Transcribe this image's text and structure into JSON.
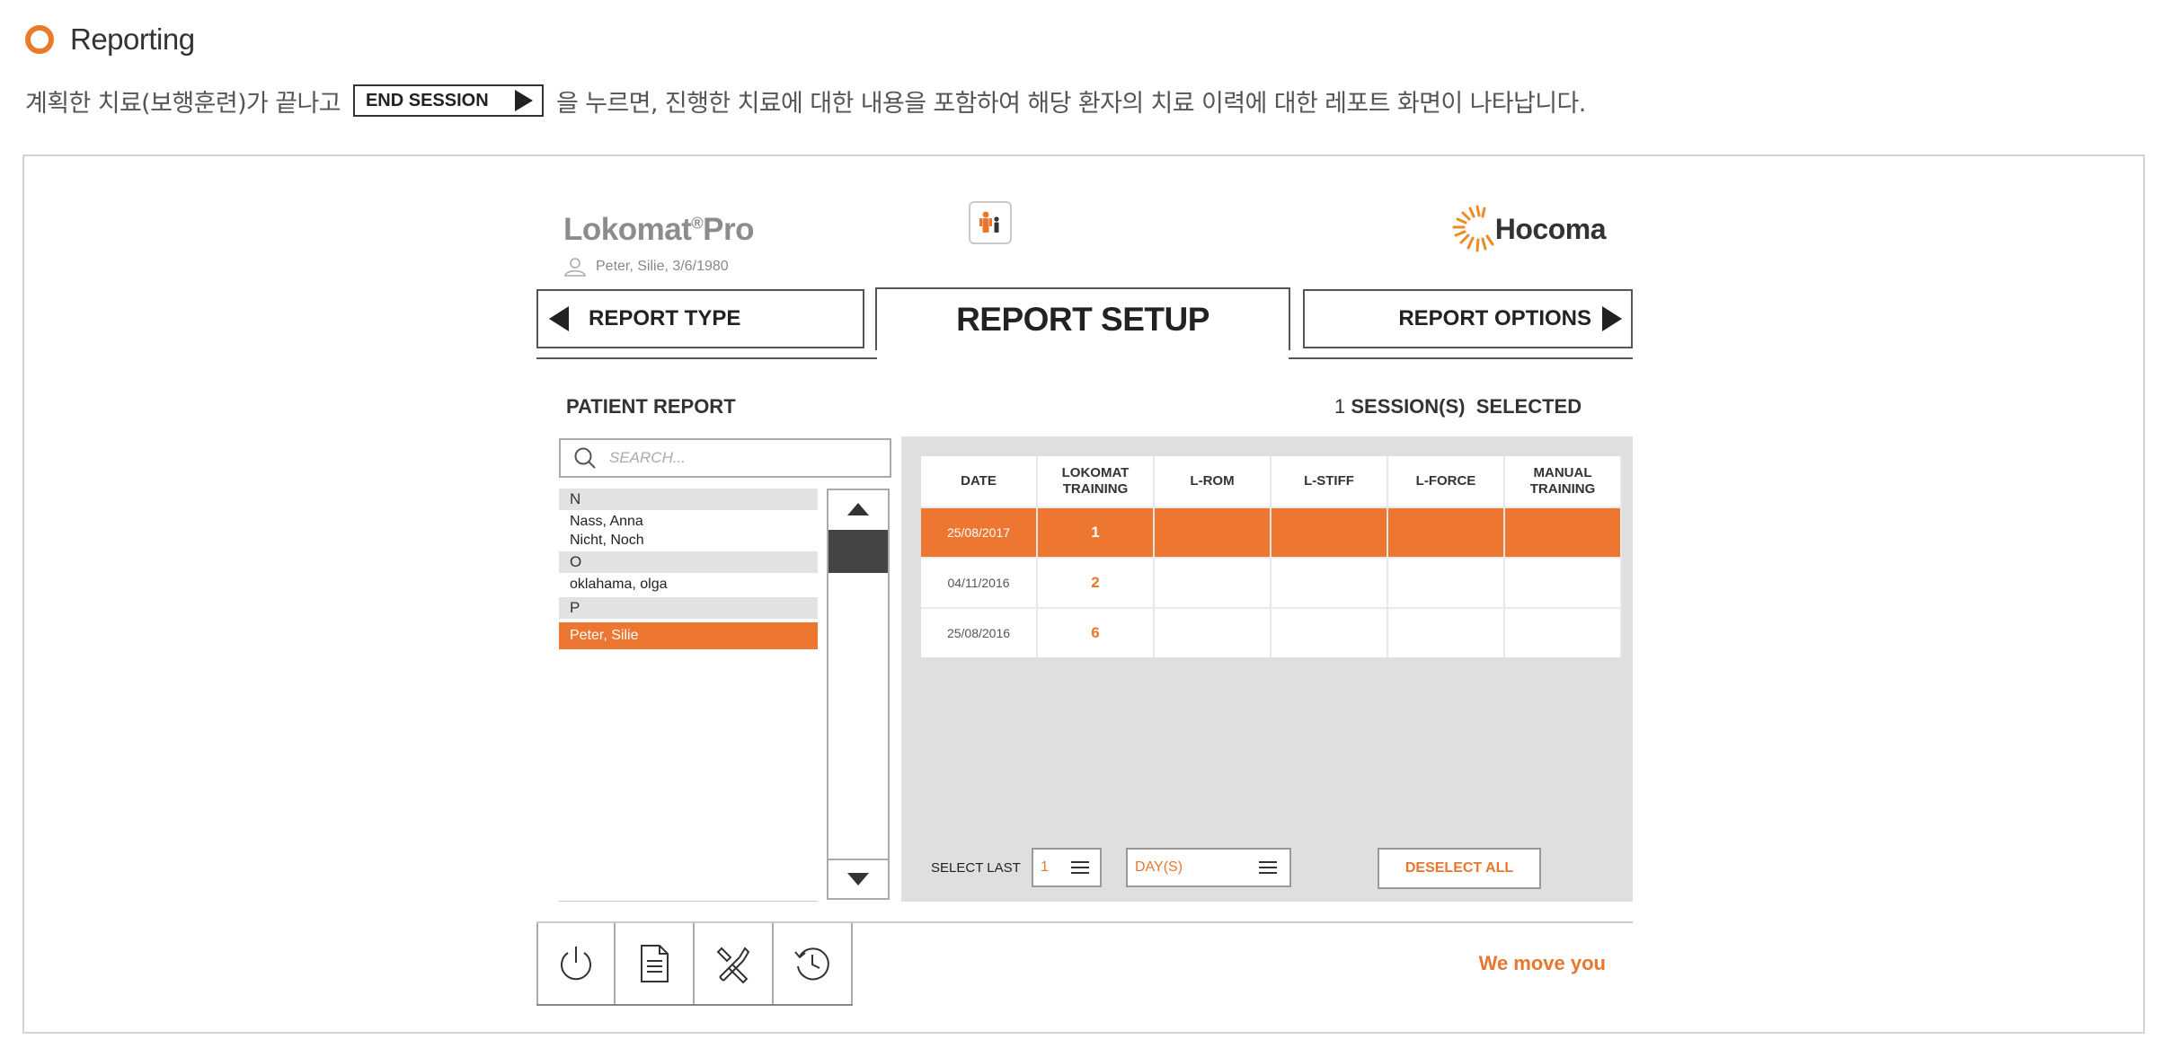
{
  "section": {
    "title": "Reporting"
  },
  "intro": {
    "before": "계획한 치료(보행훈련)가 끝나고",
    "button_label": "END SESSION",
    "after": "을 누르면, 진행한 치료에 대한 내용을 포함하여 해당 환자의 치료 이력에 대한 레포트 화면이 나타납니다."
  },
  "app": {
    "brand_main": "Lokomat",
    "brand_reg": "®",
    "brand_pro": "Pro",
    "patient": "Peter, Silie, 3/6/1980",
    "company": "Hocoma",
    "slogan": "We move you"
  },
  "tabs": {
    "left": "REPORT TYPE",
    "active": "REPORT SETUP",
    "right": "REPORT OPTIONS"
  },
  "report": {
    "section_label": "PATIENT REPORT",
    "sessions_count": "1",
    "sessions_label": "SESSION(S)  SELECTED"
  },
  "search": {
    "placeholder": "SEARCH..."
  },
  "patients": {
    "group_n": "N",
    "n1": "Nass, Anna",
    "n2": "Nicht, Noch",
    "group_o": "O",
    "o1": "oklahama, olga",
    "group_p": "P",
    "p1": "Peter, Silie"
  },
  "table": {
    "headers": [
      "DATE",
      "LOKOMAT\nTRAINING",
      "L-ROM",
      "L-STIFF",
      "L-FORCE",
      "MANUAL\nTRAINING"
    ],
    "rows": [
      {
        "date": "25/08/2017",
        "training": "1",
        "selected": true
      },
      {
        "date": "04/11/2016",
        "training": "2",
        "selected": false
      },
      {
        "date": "25/08/2016",
        "training": "6",
        "selected": false
      }
    ]
  },
  "filter": {
    "select_last_label": "SELECT LAST",
    "count_value": "1",
    "unit_value": "DAY(S)",
    "deselect_label": "DESELECT ALL"
  },
  "colors": {
    "accent": "#ed7630",
    "text": "#222222",
    "panel": "#dedfe0"
  },
  "icons": [
    "power-icon",
    "document-icon",
    "tools-icon",
    "history-icon",
    "person-icon",
    "pair-icon",
    "search-icon",
    "hocoma-logo-icon"
  ]
}
